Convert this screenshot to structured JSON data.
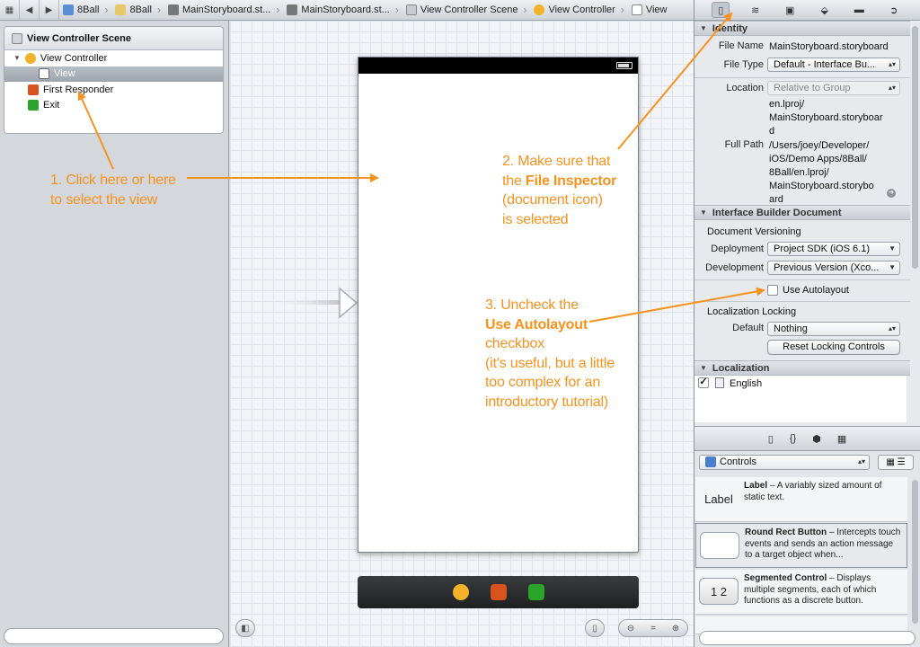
{
  "jumpbar": {
    "crumbs": [
      "8Ball",
      "8Ball",
      "MainStoryboard.st...",
      "MainStoryboard.st...",
      "View Controller Scene",
      "View Controller",
      "View"
    ]
  },
  "outline": {
    "scene_title": "View Controller Scene",
    "items": [
      {
        "label": "View Controller"
      },
      {
        "label": "View"
      },
      {
        "label": "First Responder"
      },
      {
        "label": "Exit"
      }
    ]
  },
  "inspector": {
    "identity": {
      "header": "Identity",
      "file_name_label": "File Name",
      "file_name": "MainStoryboard.storyboard",
      "file_type_label": "File Type",
      "file_type": "Default - Interface Bu...",
      "location_label": "Location",
      "location": "Relative to Group",
      "location_path_1": "en.lproj/",
      "location_path_2": "MainStoryboard.storyboar",
      "location_path_3": "d",
      "full_path_label": "Full Path",
      "full_path_1": "/Users/joey/Developer/",
      "full_path_2": "iOS/Demo Apps/8Ball/",
      "full_path_3": "8Ball/en.lproj/",
      "full_path_4": "MainStoryboard.storybo",
      "full_path_5": "ard"
    },
    "ibdoc": {
      "header": "Interface Builder Document",
      "versioning_label": "Document Versioning",
      "deployment_label": "Deployment",
      "deployment": "Project SDK (iOS 6.1)",
      "development_label": "Development",
      "development": "Previous Version (Xco...",
      "autolayout_label": "Use Autolayout",
      "locking_label": "Localization Locking",
      "default_label": "Default",
      "default_value": "Nothing",
      "reset_button": "Reset Locking Controls"
    },
    "localization": {
      "header": "Localization",
      "english": "English"
    }
  },
  "library": {
    "category": "Controls",
    "items": [
      {
        "thumb": "Label",
        "name": "Label",
        "desc": " – A variably sized amount of static text."
      },
      {
        "thumb": "",
        "name": "Round Rect Button",
        "desc": " – Intercepts touch events and sends an action message to a target object when..."
      },
      {
        "thumb": "1 2",
        "name": "Segmented Control",
        "desc": " – Displays multiple segments, each of which functions as a discrete button."
      }
    ]
  },
  "annotations": {
    "step1_line1": "1. Click here or here",
    "step1_line2": "to select the view",
    "step2_line1": "2. Make sure that",
    "step2_the": "the ",
    "step2_bold": "File Inspector",
    "step2_line3": "(document icon)",
    "step2_line4": "is selected",
    "step3_line1": "3. Uncheck the",
    "step3_bold": "Use Autolayout",
    "step3_line3": "checkbox",
    "step3_line4": "(it’s useful, but a little",
    "step3_line5": "too complex for an",
    "step3_line6": "introductory tutorial)"
  },
  "colors": {
    "annotation": "#f7921e",
    "selection": "#9ea4ad"
  }
}
